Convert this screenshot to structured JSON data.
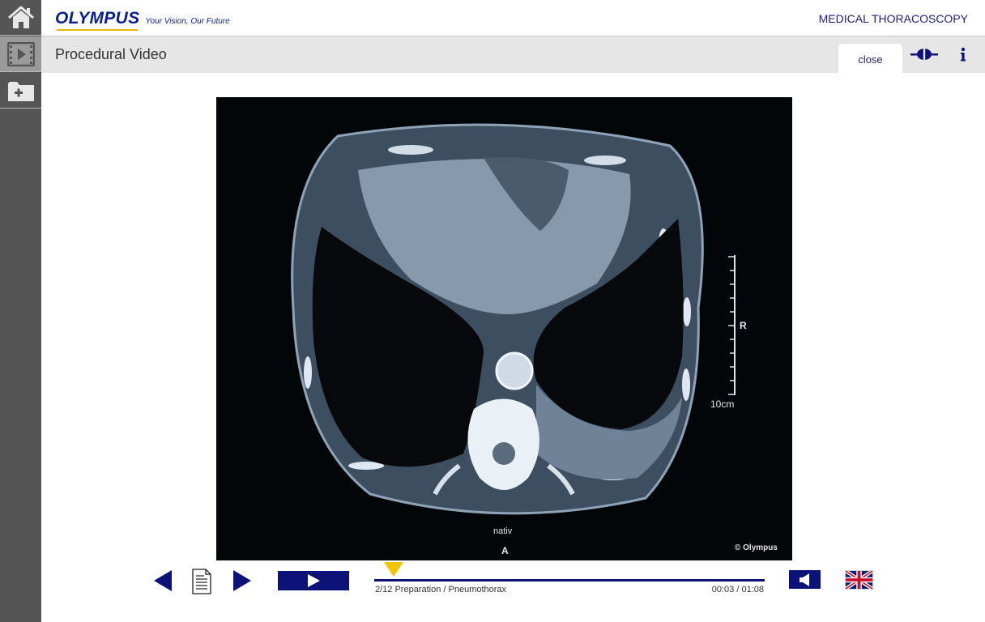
{
  "sidebar": {
    "items": [
      {
        "icon": "home-icon"
      },
      {
        "icon": "film-play-icon",
        "active": true
      },
      {
        "icon": "folder-add-icon"
      }
    ]
  },
  "header": {
    "brand": "OLYMPUS",
    "tagline": "Your Vision, Our Future",
    "app_title": "MEDICAL THORACOSCOPY"
  },
  "titlebar": {
    "title": "Procedural Video",
    "close_label": "close",
    "connect_icon": "plug-connection-icon",
    "info_icon": "info-icon"
  },
  "video": {
    "overlay_r": "R",
    "overlay_scale": "10cm",
    "overlay_nativ": "nativ",
    "overlay_a": "A",
    "watermark": "© Olympus"
  },
  "player": {
    "chapter": "2/12 Preparation / Pneumothorax",
    "timecode": "00:03 / 01:08",
    "progress_fraction": 0.05,
    "language_icon": "uk-flag-icon"
  },
  "colors": {
    "brand_blue": "#0d1278",
    "accent_yellow": "#f5c400",
    "rail_gray": "#555555"
  }
}
